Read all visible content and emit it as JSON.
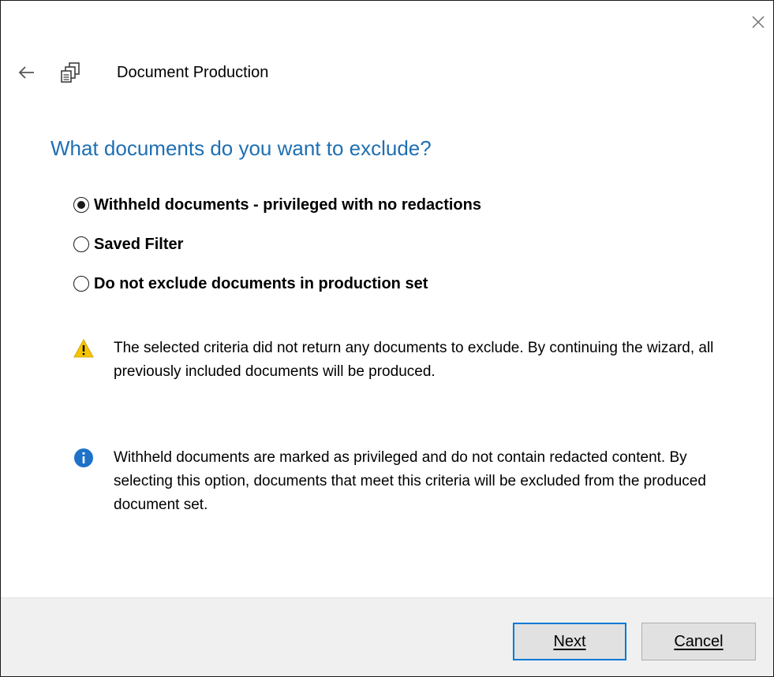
{
  "window": {
    "title": "Document Production"
  },
  "icons": {
    "close": "close-icon",
    "back": "back-arrow-icon",
    "app": "document-production-icon",
    "warning": "warning-icon",
    "info": "info-icon"
  },
  "main": {
    "question": "What documents do you want to exclude?",
    "options": [
      {
        "label": "Withheld documents - privileged with no redactions",
        "selected": true
      },
      {
        "label": "Saved Filter",
        "selected": false
      },
      {
        "label": "Do not exclude documents in production set",
        "selected": false
      }
    ],
    "warning_text": "The selected criteria did not return any documents to exclude. By continuing the wizard, all previously included documents will be produced.",
    "info_text": "Withheld documents are marked as privileged and do not contain redacted content. By selecting this option, documents that meet this criteria will be excluded from the produced document set."
  },
  "footer": {
    "next_label": "Next",
    "cancel_label": "Cancel"
  },
  "colors": {
    "accent": "#1f6fb2",
    "warning": "#f5c400",
    "info": "#1e72c8",
    "focus_border": "#0078d7"
  }
}
